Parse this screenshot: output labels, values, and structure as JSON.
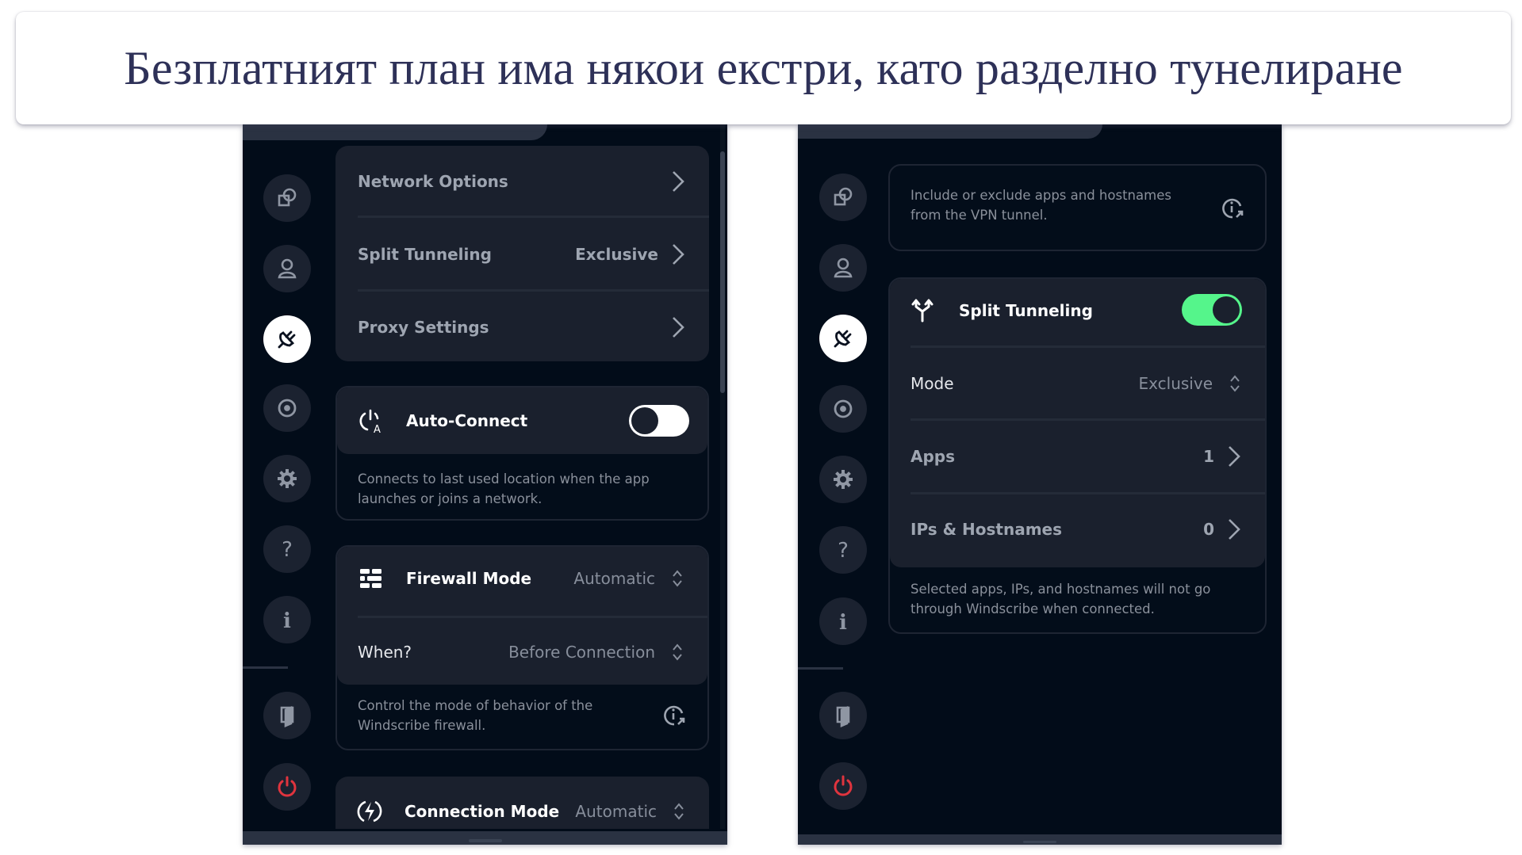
{
  "caption": "Безплатният план има някои екстри, като разделно тунелиране",
  "colors": {
    "panel_bg": "#020c19",
    "card_bg": "#1a202d",
    "toggle_on": "#55f58b",
    "power_red": "#e0343e",
    "title_text": "#2e3158"
  },
  "sidebar": {
    "items": [
      {
        "icon": "connection-windows-icon",
        "label": "General"
      },
      {
        "icon": "account-icon",
        "label": "Account"
      },
      {
        "icon": "connection-plug-icon",
        "label": "Connection",
        "active": true
      },
      {
        "icon": "robert-icon",
        "label": "R.O.B.E.R.T"
      },
      {
        "icon": "gear-icon",
        "label": "Advanced"
      },
      {
        "icon": "help-icon",
        "label": "Help"
      },
      {
        "icon": "info-icon",
        "label": "About"
      },
      {
        "icon": "book-exit-icon",
        "label": "Sign out"
      },
      {
        "icon": "power-icon",
        "label": "Quit"
      }
    ]
  },
  "left": {
    "nav_card": {
      "rows": [
        {
          "label": "Network Options",
          "value": ""
        },
        {
          "label": "Split Tunneling",
          "value": "Exclusive"
        },
        {
          "label": "Proxy Settings",
          "value": ""
        }
      ]
    },
    "auto_connect": {
      "label": "Auto-Connect",
      "enabled": false,
      "description_line1": "Connects to last used location when the app",
      "description_line2": "launches or joins a network."
    },
    "firewall": {
      "label": "Firewall Mode",
      "value": "Automatic",
      "when_label": "When?",
      "when_value": "Before Connection",
      "description_line1": "Control the mode of behavior of the",
      "description_line2": "Windscribe firewall."
    },
    "connection_mode": {
      "label": "Connection Mode",
      "value": "Automatic"
    }
  },
  "right": {
    "info": {
      "description_line1": "Include or exclude apps and hostnames",
      "description_line2": "from the VPN tunnel."
    },
    "split_tunneling": {
      "label": "Split Tunneling",
      "enabled": true,
      "mode_label": "Mode",
      "mode_value": "Exclusive",
      "apps_label": "Apps",
      "apps_count": "1",
      "ips_label": "IPs & Hostnames",
      "ips_count": "0",
      "description_line1": "Selected apps, IPs, and hostnames will not go",
      "description_line2": "through Windscribe when connected."
    }
  }
}
